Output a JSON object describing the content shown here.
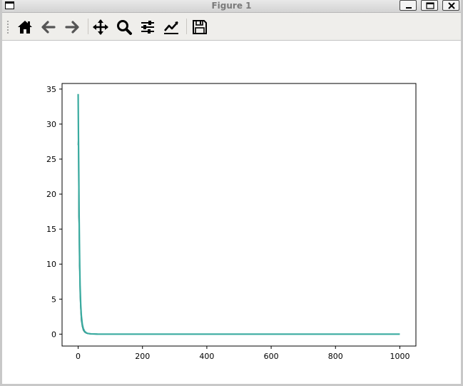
{
  "window": {
    "title": "Figure 1"
  },
  "toolbar": {
    "buttons": [
      {
        "name": "home-button",
        "icon": "home-icon"
      },
      {
        "name": "back-button",
        "icon": "arrow-left-icon"
      },
      {
        "name": "forward-button",
        "icon": "arrow-right-icon"
      },
      {
        "name": "pan-button",
        "icon": "move-icon"
      },
      {
        "name": "zoom-button",
        "icon": "magnifier-icon"
      },
      {
        "name": "configure-subplots-button",
        "icon": "sliders-icon"
      },
      {
        "name": "edit-axis-button",
        "icon": "line-chart-icon"
      },
      {
        "name": "save-button",
        "icon": "floppy-disk-icon"
      }
    ]
  },
  "chart_data": {
    "type": "line",
    "xlim": [
      -50,
      1050
    ],
    "ylim": [
      -1.7,
      35.8
    ],
    "xticks": [
      0,
      200,
      400,
      600,
      800,
      1000
    ],
    "yticks": [
      0,
      5,
      10,
      15,
      20,
      25,
      30,
      35
    ],
    "grid": false,
    "colors": {
      "dark": "#1f5f5f",
      "main": "#3aaba0"
    },
    "series": [
      {
        "values_description": "decay",
        "color": "#3aaba0",
        "x": [
          0,
          1,
          2,
          3,
          4,
          5,
          6,
          8,
          10,
          13,
          16,
          20,
          25,
          30,
          40,
          60,
          100,
          200,
          400,
          600,
          800,
          1000
        ],
        "y": [
          34.3,
          28.0,
          23.0,
          17.0,
          13.0,
          9.5,
          7.0,
          4.2,
          2.6,
          1.4,
          0.8,
          0.4,
          0.2,
          0.1,
          0.04,
          0.01,
          0.0,
          0.0,
          0.0,
          0.0,
          0.0,
          0.0
        ]
      },
      {
        "color": "#1f5f5f",
        "x": [
          0,
          1,
          2,
          3,
          4,
          5,
          6,
          8,
          10,
          13,
          16,
          20,
          25,
          30,
          40,
          60
        ],
        "y": [
          27.0,
          28.3,
          16.8,
          15.5,
          9.8,
          9.0,
          5.8,
          3.6,
          2.0,
          1.1,
          0.6,
          0.3,
          0.15,
          0.08,
          0.03,
          0.0
        ]
      }
    ]
  }
}
